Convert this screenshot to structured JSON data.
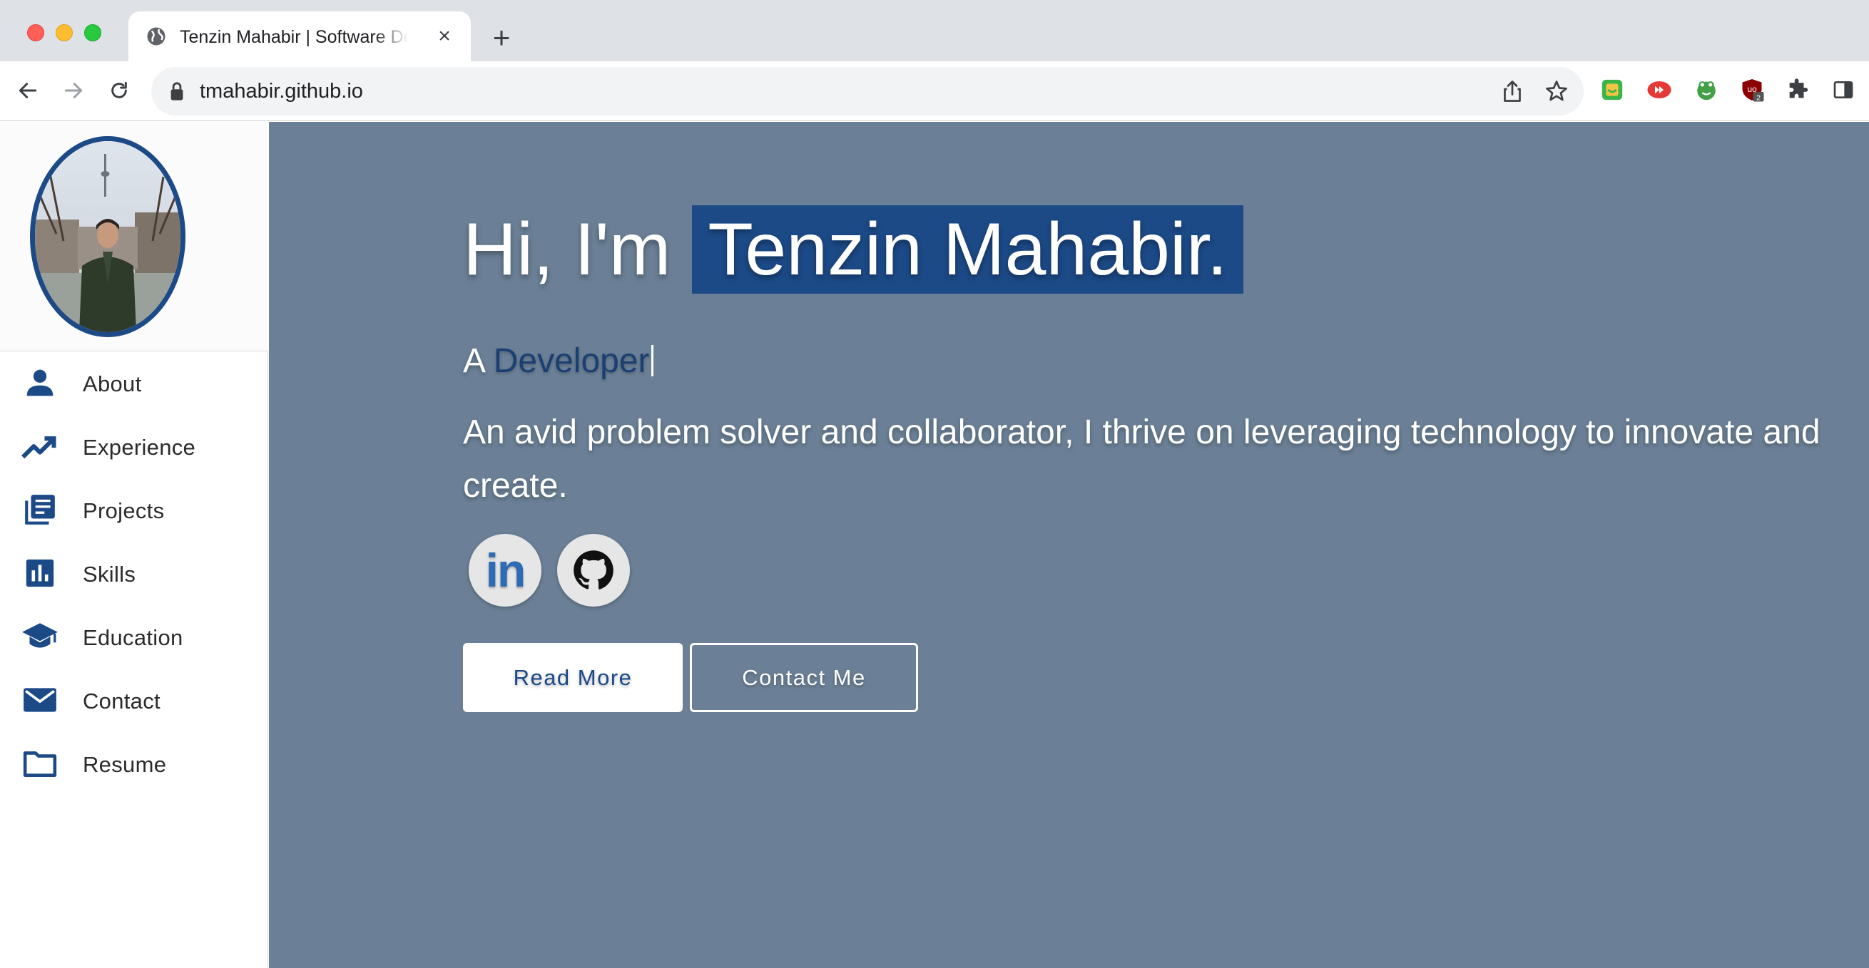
{
  "browser": {
    "tab": {
      "title": "Tenzin Mahabir | Software Developer",
      "favicon": "globe-icon",
      "close_label": "×"
    },
    "new_tab_label": "+",
    "url": "tmahabir.github.io",
    "extensions": [
      {
        "name": "grammarly-style-extension",
        "color": "#3bb54a"
      },
      {
        "name": "youtube-extension",
        "color": "#e53935"
      },
      {
        "name": "frog-extension",
        "color": "#43a047"
      },
      {
        "name": "ublock-origin-extension",
        "color": "#8b0000",
        "badge": "2"
      },
      {
        "name": "puzzle-extensions-icon",
        "color": "#3c4043"
      },
      {
        "name": "side-panel-icon",
        "color": "#3c4043"
      }
    ]
  },
  "sidebar": {
    "accent": "#1c4a87",
    "items": [
      {
        "label": "About",
        "icon": "person-icon"
      },
      {
        "label": "Experience",
        "icon": "trending-up-icon"
      },
      {
        "label": "Projects",
        "icon": "library-books-icon"
      },
      {
        "label": "Skills",
        "icon": "bar-chart-icon"
      },
      {
        "label": "Education",
        "icon": "graduation-cap-icon"
      },
      {
        "label": "Contact",
        "icon": "mail-icon"
      },
      {
        "label": "Resume",
        "icon": "folder-icon"
      }
    ]
  },
  "hero": {
    "greeting": "Hi, I'm",
    "name": "Tenzin Mahabir.",
    "prefix": "A",
    "role": "Developer",
    "tagline": "An avid problem solver and collaborator, I thrive on leveraging technology to innovate and create.",
    "social": [
      {
        "name": "linkedin",
        "label": "in"
      },
      {
        "name": "github",
        "icon": "github-icon"
      }
    ],
    "buttons": {
      "read_more": "Read More",
      "contact_me": "Contact Me"
    },
    "background": "#6b8096",
    "highlight": "#1c4a87"
  }
}
